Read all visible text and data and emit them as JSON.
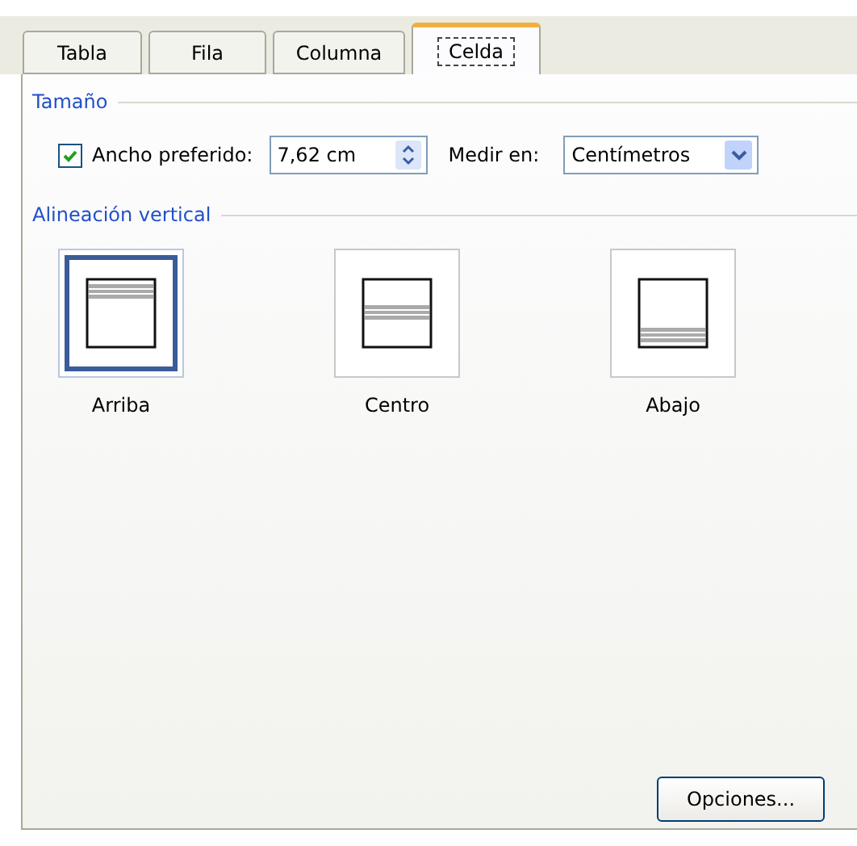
{
  "tabs": [
    {
      "label": "Tabla",
      "selected": false
    },
    {
      "label": "Fila",
      "selected": false
    },
    {
      "label": "Columna",
      "selected": false
    },
    {
      "label": "Celda",
      "selected": true
    }
  ],
  "size": {
    "label": "Tamaño",
    "preferred_width": {
      "label": "Ancho preferido:",
      "checked": true,
      "value": "7,62 cm"
    },
    "measure": {
      "label": "Medir en:",
      "value": "Centímetros"
    }
  },
  "vertical_alignment": {
    "label": "Alineación vertical",
    "options": [
      {
        "label": "Arriba",
        "kind": "top",
        "selected": true
      },
      {
        "label": "Centro",
        "kind": "center",
        "selected": false
      },
      {
        "label": "Abajo",
        "kind": "bottom",
        "selected": false
      }
    ]
  },
  "buttons": [
    "Opciones..."
  ]
}
